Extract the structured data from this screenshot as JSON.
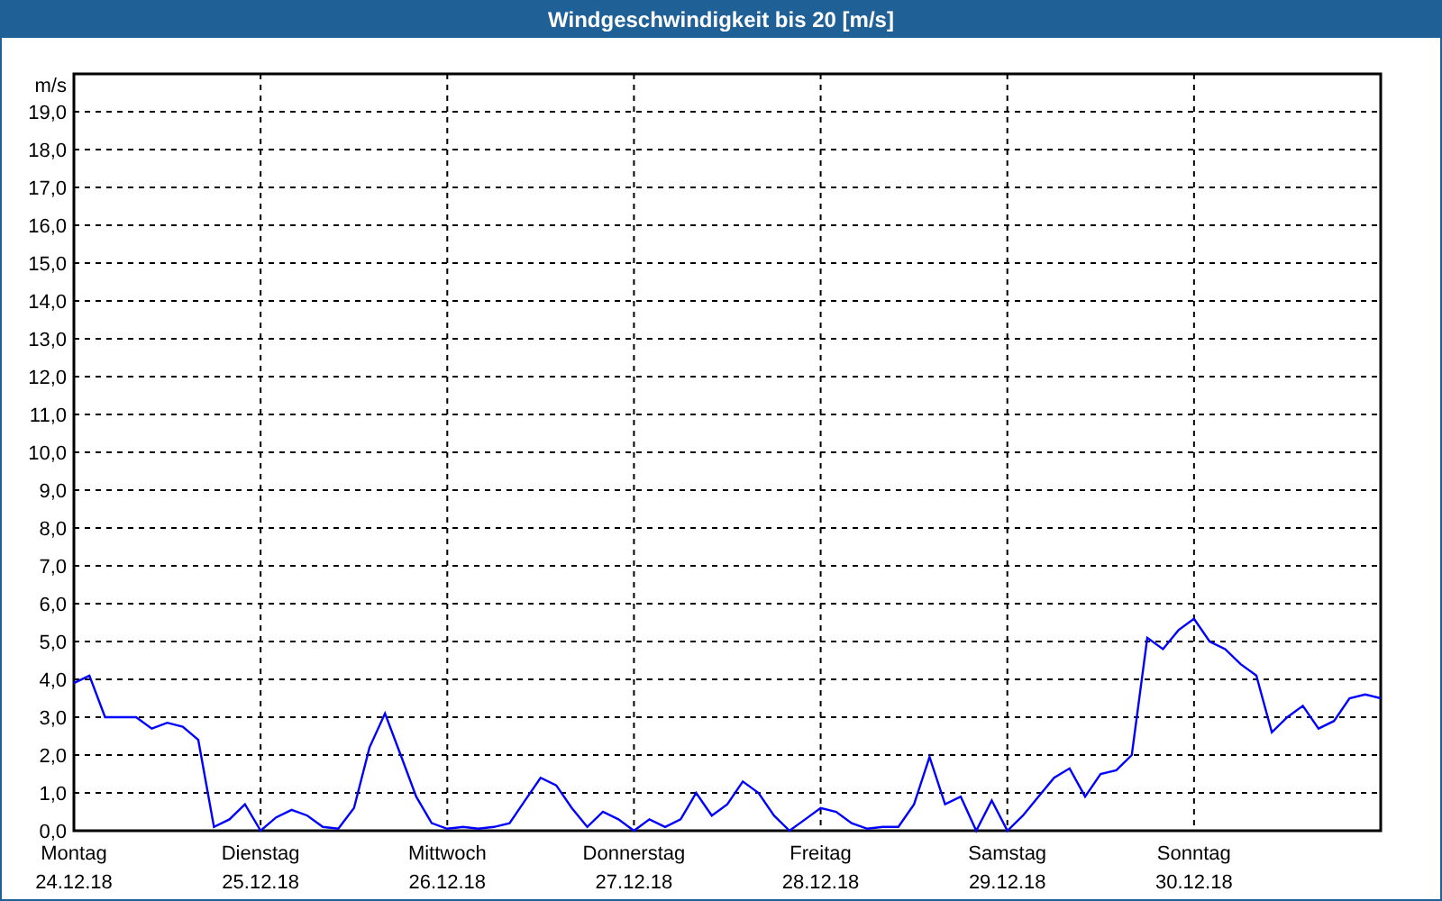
{
  "chart_data": {
    "type": "line",
    "title": "Windgeschwindigkeit bis 20 [m/s]",
    "ylabel": "m/s",
    "ylim": [
      0,
      20
    ],
    "grid": true,
    "categories": [
      "Montag\n24.12.18",
      null,
      null,
      null,
      null,
      null,
      null,
      null,
      null,
      null,
      null,
      null,
      "Dienstag\n25.12.18",
      null,
      null,
      null,
      null,
      null,
      null,
      null,
      null,
      null,
      null,
      null,
      "Mittwoch\n26.12.18",
      null,
      null,
      null,
      null,
      null,
      null,
      null,
      null,
      null,
      null,
      null,
      "Donnerstag\n27.12.18",
      null,
      null,
      null,
      null,
      null,
      null,
      null,
      null,
      null,
      null,
      null,
      "Freitag\n28.12.18",
      null,
      null,
      null,
      null,
      null,
      null,
      null,
      null,
      null,
      null,
      null,
      "Samstag\n29.12.18",
      null,
      null,
      null,
      null,
      null,
      null,
      null,
      null,
      null,
      null,
      null,
      "Sonntag\n30.12.18",
      null,
      null,
      null,
      null,
      null,
      null,
      null,
      null,
      null,
      null,
      null,
      null
    ],
    "yticks": [
      {
        "value": 0,
        "label": "0,0"
      },
      {
        "value": 1,
        "label": "1,0"
      },
      {
        "value": 2,
        "label": "2,0"
      },
      {
        "value": 3,
        "label": "3,0"
      },
      {
        "value": 4,
        "label": "4,0"
      },
      {
        "value": 5,
        "label": "5,0"
      },
      {
        "value": 6,
        "label": "6,0"
      },
      {
        "value": 7,
        "label": "7,0"
      },
      {
        "value": 8,
        "label": "8,0"
      },
      {
        "value": 9,
        "label": "9,0"
      },
      {
        "value": 10,
        "label": "10,0"
      },
      {
        "value": 11,
        "label": "11,0"
      },
      {
        "value": 12,
        "label": "12,0"
      },
      {
        "value": 13,
        "label": "13,0"
      },
      {
        "value": 14,
        "label": "14,0"
      },
      {
        "value": 15,
        "label": "15,0"
      },
      {
        "value": 16,
        "label": "16,0"
      },
      {
        "value": 17,
        "label": "17,0"
      },
      {
        "value": 18,
        "label": "18,0"
      },
      {
        "value": 19,
        "label": "19,0"
      }
    ],
    "series": [
      {
        "color": "#0000ff",
        "values": [
          3.9,
          4.1,
          3.0,
          3.0,
          3.0,
          2.7,
          2.85,
          2.75,
          2.4,
          0.1,
          0.3,
          0.7,
          0.0,
          0.35,
          0.55,
          0.4,
          0.1,
          0.05,
          0.6,
          2.2,
          3.1,
          2.0,
          0.9,
          0.2,
          0.05,
          0.1,
          0.05,
          0.1,
          0.2,
          0.8,
          1.4,
          1.2,
          0.6,
          0.1,
          0.5,
          0.3,
          0.0,
          0.3,
          0.1,
          0.3,
          1.0,
          0.4,
          0.7,
          1.3,
          1.0,
          0.4,
          0.0,
          0.3,
          0.6,
          0.5,
          0.2,
          0.05,
          0.1,
          0.1,
          0.7,
          1.95,
          0.7,
          0.9,
          0.0,
          0.8,
          0.0,
          0.4,
          0.9,
          1.4,
          1.65,
          0.9,
          1.5,
          1.6,
          2.0,
          5.1,
          4.8,
          5.3,
          5.6,
          5.0,
          4.8,
          4.4,
          4.1,
          2.6,
          3.0,
          3.3,
          2.7,
          2.9,
          3.5,
          3.6,
          3.5
        ]
      }
    ]
  }
}
